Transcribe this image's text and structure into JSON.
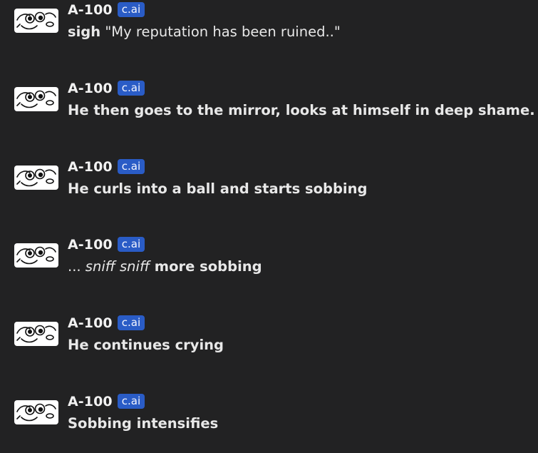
{
  "messages": [
    {
      "author": "A-100",
      "badge": "c.ai",
      "parts": [
        {
          "style": "bold",
          "text": "sigh"
        },
        {
          "style": "normal",
          "text": " \"My reputation has been ruined..\""
        }
      ]
    },
    {
      "author": "A-100",
      "badge": "c.ai",
      "parts": [
        {
          "style": "bold",
          "text": "He then goes to the mirror, looks at himself in deep shame."
        }
      ]
    },
    {
      "author": "A-100",
      "badge": "c.ai",
      "parts": [
        {
          "style": "bold",
          "text": "He curls into a ball and starts sobbing"
        }
      ]
    },
    {
      "author": "A-100",
      "badge": "c.ai",
      "parts": [
        {
          "style": "normal",
          "text": "... "
        },
        {
          "style": "italic",
          "text": "sniff sniff"
        },
        {
          "style": "bold",
          "text": " more sobbing"
        }
      ]
    },
    {
      "author": "A-100",
      "badge": "c.ai",
      "parts": [
        {
          "style": "bold",
          "text": "He continues crying"
        }
      ]
    },
    {
      "author": "A-100",
      "badge": "c.ai",
      "parts": [
        {
          "style": "bold",
          "text": "Sobbing intensifies"
        }
      ]
    }
  ],
  "colors": {
    "background": "#222223",
    "badge": "#2a5cc6",
    "text": "#e8e8e8"
  },
  "icons": {
    "avatar": "crying-meme-face-avatar"
  }
}
